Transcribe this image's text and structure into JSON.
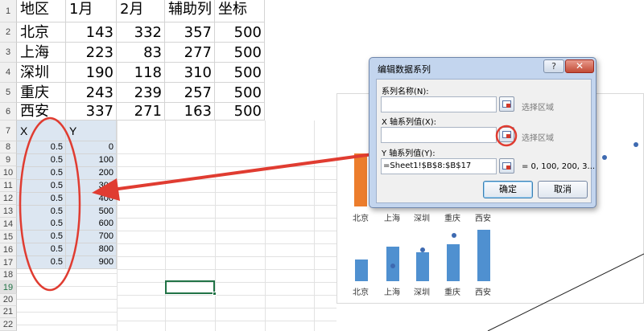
{
  "spreadsheet": {
    "row_numbers": [
      "1",
      "2",
      "3",
      "4",
      "5",
      "6",
      "7",
      "8",
      "9",
      "10",
      "11",
      "12",
      "13",
      "14",
      "15",
      "16",
      "17",
      "18",
      "19",
      "20",
      "21",
      "22"
    ],
    "header_row": [
      "地区",
      "1月",
      "2月",
      "辅助列",
      "坐标"
    ],
    "data_rows": [
      [
        "北京",
        "143",
        "332",
        "357",
        "500"
      ],
      [
        "上海",
        "223",
        "83",
        "277",
        "500"
      ],
      [
        "深圳",
        "190",
        "118",
        "310",
        "500"
      ],
      [
        "重庆",
        "243",
        "239",
        "257",
        "500"
      ],
      [
        "西安",
        "337",
        "271",
        "163",
        "500"
      ]
    ],
    "xy_header": [
      "X",
      "Y"
    ],
    "xy_rows": [
      [
        "0.5",
        "0"
      ],
      [
        "0.5",
        "100"
      ],
      [
        "0.5",
        "200"
      ],
      [
        "0.5",
        "300"
      ],
      [
        "0.5",
        "400"
      ],
      [
        "0.5",
        "500"
      ],
      [
        "0.5",
        "600"
      ],
      [
        "0.5",
        "700"
      ],
      [
        "0.5",
        "800"
      ],
      [
        "0.5",
        "900"
      ]
    ],
    "selected_cell_row": "19"
  },
  "chart": {
    "categories": [
      "北京",
      "上海",
      "深圳",
      "重庆",
      "西安"
    ],
    "colors": {
      "bar": "#4f90d0",
      "highlight_bar": "#ec7d2c",
      "dot": "#3e6ab1"
    }
  },
  "dialog": {
    "title": "编辑数据系列",
    "help_label": "?",
    "close_label": "✕",
    "series_name_label": "系列名称(N):",
    "series_name_value": "",
    "x_values_label": "X 轴系列值(X):",
    "x_values_value": "",
    "y_values_label": "Y 轴系列值(Y):",
    "y_values_value": "=Sheet1!$B$8:$B$17",
    "select_range_hint": "选择区域",
    "y_values_preview": "= 0, 100, 200, 3...",
    "ok_label": "确定",
    "cancel_label": "取消"
  },
  "annotation": {
    "color": "#e03c31"
  }
}
